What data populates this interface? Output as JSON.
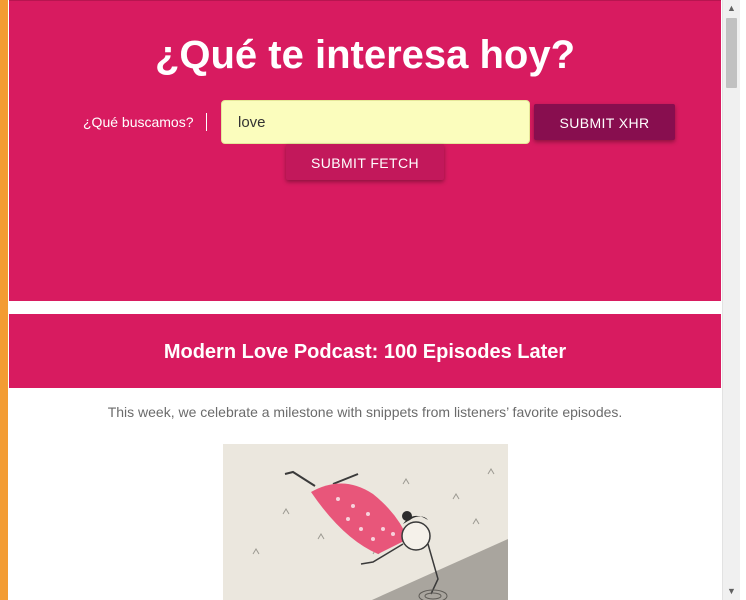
{
  "hero": {
    "title": "¿Qué te interesa hoy?",
    "search_label": "¿Qué buscamos?",
    "search_value": "love",
    "submit_xhr_label": "SUBMIT XHR",
    "submit_fetch_label": "SUBMIT FETCH"
  },
  "card": {
    "title": "Modern Love Podcast: 100 Episodes Later",
    "description": "This week, we celebrate a milestone with snippets from listeners’ favorite episodes."
  },
  "scrollbar": {
    "up_icon": "triangle-up",
    "down_icon": "triangle-down"
  },
  "colors": {
    "accent": "#d81b60",
    "button_dark": "#880e4f",
    "input_bg": "#fbfdbd",
    "window_border": "#f39c33"
  }
}
